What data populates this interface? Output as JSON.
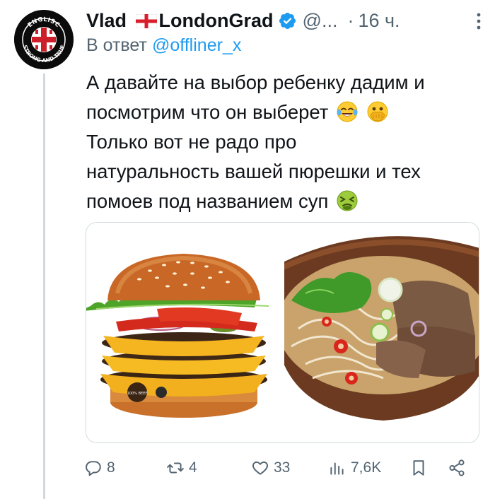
{
  "author": {
    "display_name": "Vlad",
    "display_name_suffix": "LondonGrad",
    "handle": "@...",
    "time": "16 ч.",
    "avatar_text": "ENGLISC STRONG AND TRUE",
    "avatar_top": "ENGLISC",
    "avatar_bottom": "STRONG AND TRUE"
  },
  "reply": {
    "prefix": "В ответ",
    "mention": "@offliner_x"
  },
  "text_lines": [
    "А давайте на выбор ребенку дадим и",
    "посмотрим что он выберет",
    "Только вот не радо про",
    "натуральность вашей пюрешки и тех",
    "помоев под названием суп"
  ],
  "emojis": [
    "face-with-tears-of-joy",
    "face-with-open-eyes-and-hand-over-mouth",
    "nauseated-face"
  ],
  "media": [
    {
      "name": "burger-image",
      "description_icon": "burger",
      "badge_text": "100% BEEF"
    },
    {
      "name": "soup-image",
      "description_icon": "pho-bowl"
    }
  ],
  "actions": {
    "replies": "8",
    "reposts": "4",
    "likes": "33",
    "views": "7,6K"
  },
  "colors": {
    "accent": "#1d9bf0",
    "secondary_text": "#536471",
    "primary_text": "#0f1419",
    "divider": "#cfd9de"
  }
}
